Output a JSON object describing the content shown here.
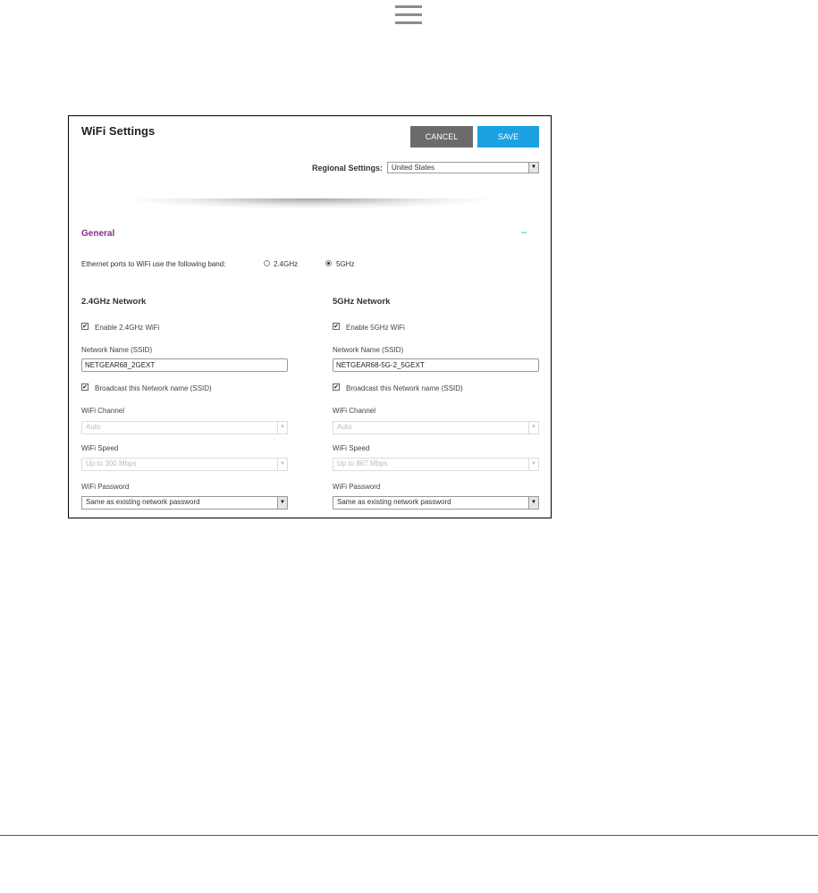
{
  "header": {
    "menu_icon": "hamburger-menu-icon"
  },
  "dialog": {
    "title": "WiFi Settings",
    "cancel_label": "CANCEL",
    "save_label": "SAVE",
    "regional_label": "Regional Settings:",
    "regional_value": "United States"
  },
  "general": {
    "title": "General",
    "collapse_symbol": "–",
    "band_label": "Ethernet ports to WiFi use the following band:",
    "band_options": [
      {
        "label": "2.4GHz",
        "selected": false
      },
      {
        "label": "5GHz",
        "selected": true
      }
    ]
  },
  "network_24": {
    "title": "2.4GHz Network",
    "enable_label": "Enable 2.4GHz WiFi",
    "enable_checked": true,
    "ssid_label": "Network Name (SSID)",
    "ssid_value": "NETGEAR68_2GEXT",
    "broadcast_label": "Broadcast this Network name (SSID)",
    "broadcast_checked": true,
    "channel_label": "WiFi Channel",
    "channel_value": "Auto",
    "speed_label": "WiFi Speed",
    "speed_value": "Up to 300 Mbps",
    "password_label": "WiFi Password",
    "password_value": "Same as existing network password"
  },
  "network_5": {
    "title": "5GHz Network",
    "enable_label": "Enable 5GHz WiFi",
    "enable_checked": true,
    "ssid_label": "Network Name (SSID)",
    "ssid_value": "NETGEAR68-5G-2_5GEXT",
    "broadcast_label": "Broadcast this Network name (SSID)",
    "broadcast_checked": true,
    "channel_label": "WiFi Channel",
    "channel_value": "Auto",
    "speed_label": "WiFi Speed",
    "speed_value": "Up to 867 Mbps",
    "password_label": "WiFi Password",
    "password_value": "Same as existing network password"
  },
  "colors": {
    "accent": "#1ba1e2",
    "section_title": "#8a2b8a",
    "cancel_bg": "#6b6b6b"
  }
}
